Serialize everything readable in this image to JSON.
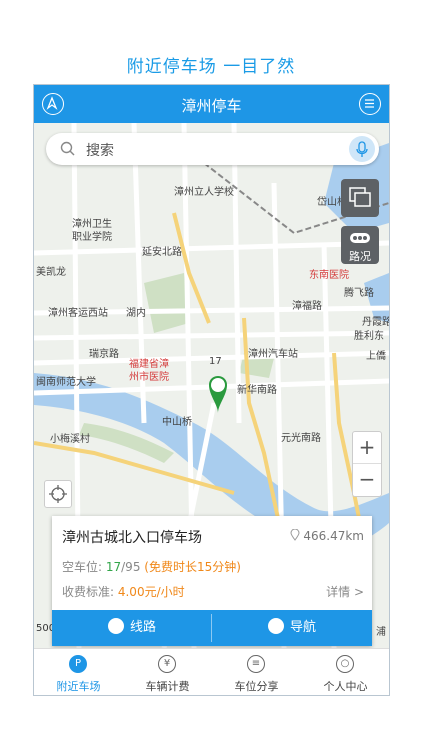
{
  "headline": "附近停车场  一目了然",
  "app": {
    "title": "漳州停车"
  },
  "search": {
    "placeholder": "搜索"
  },
  "map": {
    "traffic_label": "路况",
    "marker_count": "17",
    "scale_text": "500",
    "labels": [
      "漳州立人学校",
      "岱山村",
      "漳州卫生",
      "职业学院",
      "东南医院",
      "美凯龙",
      "漳州客运西站",
      "湖内",
      "腾飞路",
      "胜利东",
      "福建省漳",
      "州市医院",
      "漳州汽车站",
      "上僑",
      "丹霞路",
      "瑞京路",
      "闽南师范大学",
      "中山桥",
      "元光南路",
      "新华南路",
      "小梅溪村",
      "漳福路",
      "延安北路",
      "浦"
    ]
  },
  "card": {
    "name": "漳州古城北入口停车场",
    "distance": "466.47km",
    "vacancy_label": "空车位: ",
    "vacancy_free": "17",
    "vacancy_total": "/95",
    "free_note": "(免费时长15分钟)",
    "fee_label": "收费标准: ",
    "fee_value": "4.00元/小时",
    "detail": "详情 >",
    "route_button": "线路",
    "nav_button": "导航"
  },
  "tabs": [
    {
      "label": "附近车场",
      "icon": "parking-icon",
      "glyph": "P"
    },
    {
      "label": "车辆计费",
      "icon": "yuan-icon",
      "glyph": "¥"
    },
    {
      "label": "车位分享",
      "icon": "share-icon",
      "glyph": "≡"
    },
    {
      "label": "个人中心",
      "icon": "user-icon",
      "glyph": "○"
    }
  ],
  "colors": {
    "accent": "#1e96e6",
    "green": "#33a64a",
    "orange": "#f0881a"
  }
}
